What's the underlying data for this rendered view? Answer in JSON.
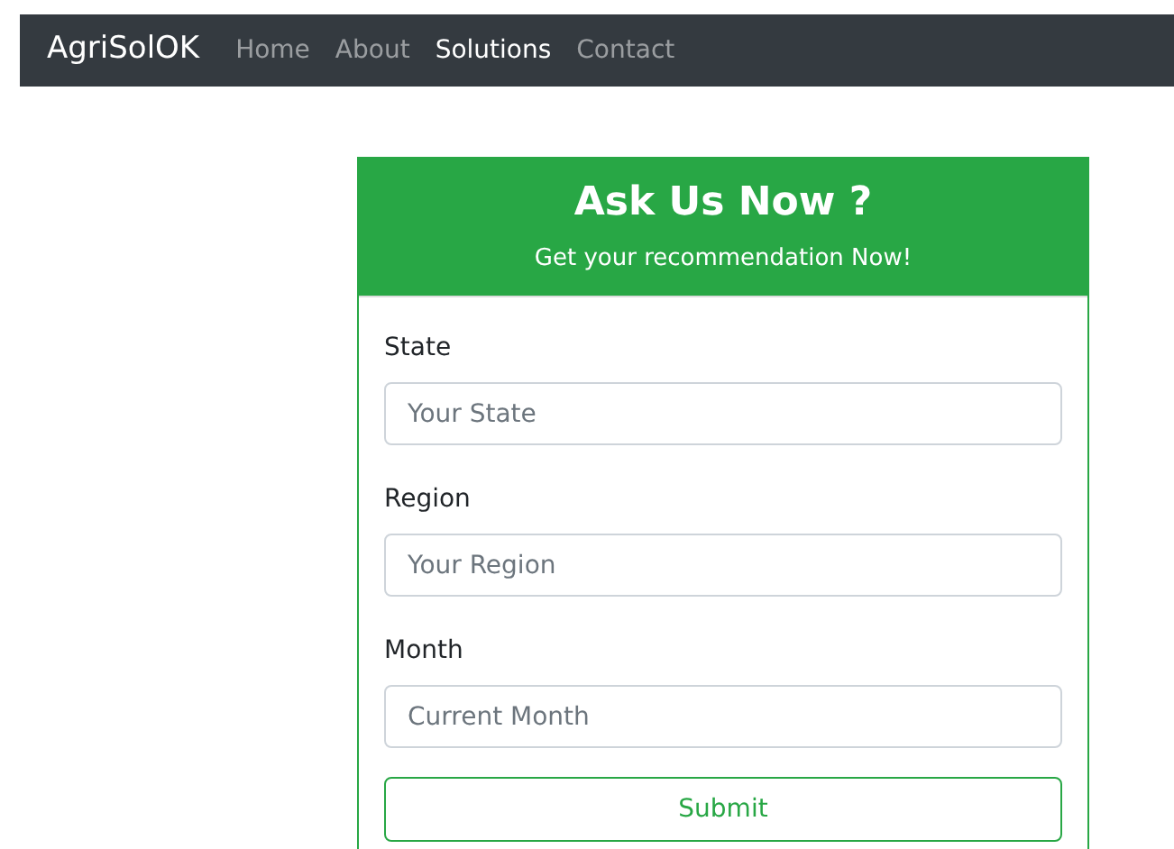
{
  "navbar": {
    "brand": "AgriSolOK",
    "links": [
      {
        "label": "Home",
        "selected": false
      },
      {
        "label": "About",
        "selected": false
      },
      {
        "label": "Solutions",
        "selected": true
      },
      {
        "label": "Contact",
        "selected": false
      }
    ]
  },
  "card": {
    "title": "Ask Us Now ?",
    "subtitle": "Get your recommendation Now!",
    "fields": [
      {
        "label": "State",
        "placeholder": "Your State"
      },
      {
        "label": "Region",
        "placeholder": "Your Region"
      },
      {
        "label": "Month",
        "placeholder": "Current Month"
      }
    ],
    "button": "Submit"
  }
}
